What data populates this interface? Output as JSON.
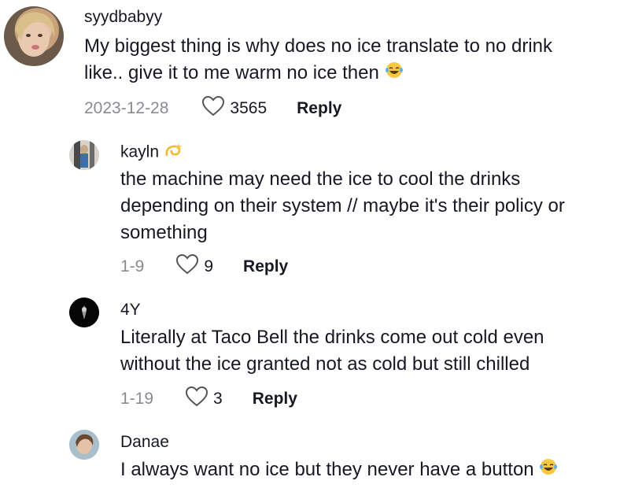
{
  "comments": [
    {
      "username": "syydbabyy",
      "text": "My biggest thing is why does no ice translate to no drink like.. give it to me warm no ice then",
      "trailing_emoji": "laughing-tears",
      "date": "2023-12-28",
      "likes": "3565",
      "reply_label": "Reply"
    },
    {
      "username": "kayln",
      "username_emoji": "dizzy",
      "text": "the machine may need the ice to cool the drinks depending on their system // maybe it's their policy or something",
      "date": "1-9",
      "likes": "9",
      "reply_label": "Reply"
    },
    {
      "username": "4Y",
      "text": "Literally at Taco Bell the drinks come out cold even without the ice granted not as cold but still chilled",
      "date": "1-19",
      "likes": "3",
      "reply_label": "Reply"
    },
    {
      "username": "Danae",
      "text": "I always want no ice but they never have a button",
      "trailing_emoji": "laughing-tears"
    }
  ]
}
